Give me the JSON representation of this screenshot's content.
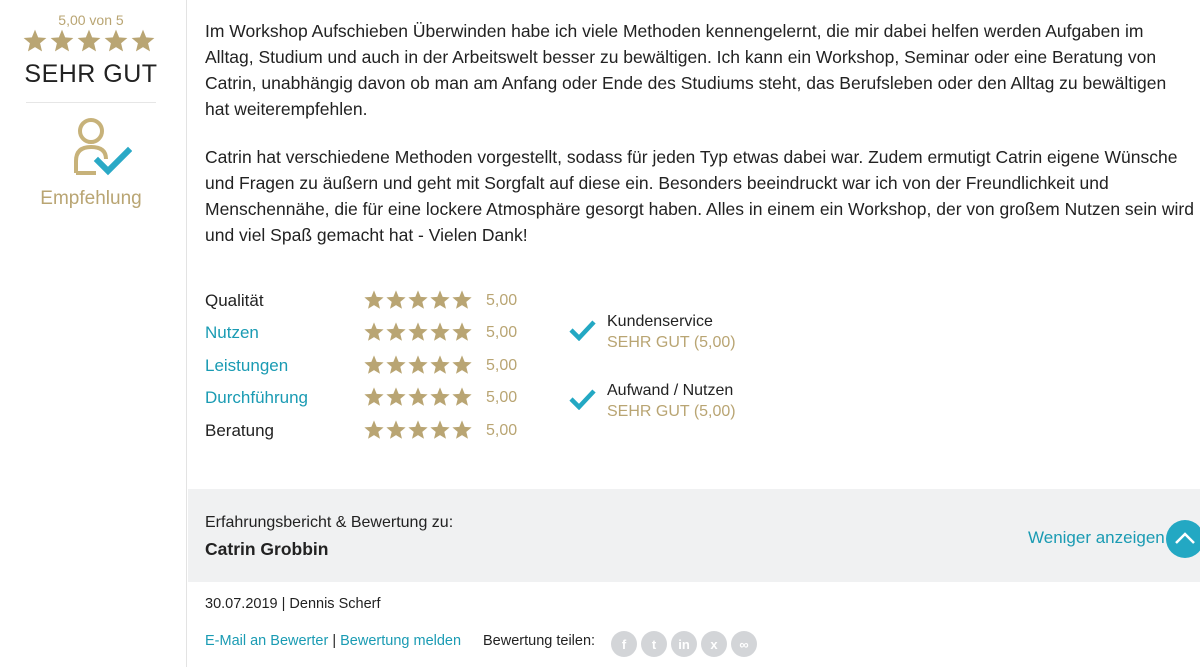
{
  "summary": {
    "score_text": "5,00 von 5",
    "stars": 5,
    "grade": "SEHR GUT",
    "recommendation": "Empfehlung"
  },
  "review": {
    "paragraphs": [
      "Im Workshop Aufschieben Überwinden habe ich viele Methoden kennengelernt, die mir dabei helfen werden Aufgaben im Alltag, Studium und auch in der Arbeitswelt besser zu bewältigen. Ich kann ein Workshop, Seminar oder eine Beratung von Catrin, unabhängig davon ob man am Anfang oder Ende des Studiums steht, das Berufsleben oder den Alltag zu bewältigen hat weiterempfehlen.",
      "Catrin hat verschiedene Methoden vorgestellt, sodass für jeden Typ etwas dabei war. Zudem ermutigt Catrin eigene Wünsche und Fragen zu äußern und geht mit Sorgfalt auf diese ein. Besonders beeindruckt war ich von der Freundlichkeit und Menschennähe, die für eine lockere Atmosphäre gesorgt haben. Alles in einem ein Workshop, der von großem Nutzen sein wird und viel Spaß gemacht hat - Vielen Dank!"
    ]
  },
  "ratings": [
    {
      "label": "Qualität",
      "value": "5,00",
      "stars": 5,
      "link": false
    },
    {
      "label": "Nutzen",
      "value": "5,00",
      "stars": 5,
      "link": true
    },
    {
      "label": "Leistungen",
      "value": "5,00",
      "stars": 5,
      "link": true
    },
    {
      "label": "Durchführung",
      "value": "5,00",
      "stars": 5,
      "link": true
    },
    {
      "label": "Beratung",
      "value": "5,00",
      "stars": 5,
      "link": false
    }
  ],
  "extras": [
    {
      "label": "Kundenservice",
      "grade": "SEHR GUT (5,00)"
    },
    {
      "label": "Aufwand / Nutzen",
      "grade": "SEHR GUT (5,00)"
    }
  ],
  "band": {
    "intro": "Erfahrungsbericht & Bewertung zu:",
    "name": "Catrin Grobbin",
    "less_label": "Weniger anzeigen"
  },
  "meta": {
    "date": "30.07.2019",
    "separator": "|",
    "author": "Dennis Scherf"
  },
  "footer": {
    "email_link": "E-Mail an Bewerter",
    "separator": "|",
    "report_link": "Bewertung melden",
    "share_label": "Bewertung teilen:",
    "share_icons": [
      "facebook-icon",
      "twitter-icon",
      "linkedin-icon",
      "xing-icon",
      "link-icon"
    ],
    "share_glyphs": [
      "f",
      "t",
      "in",
      "x",
      "∞"
    ]
  },
  "colors": {
    "gold": "#b9a573",
    "accent": "#1a9bb3",
    "check": "#23a8c3",
    "band_bg": "#f0f1f2"
  }
}
